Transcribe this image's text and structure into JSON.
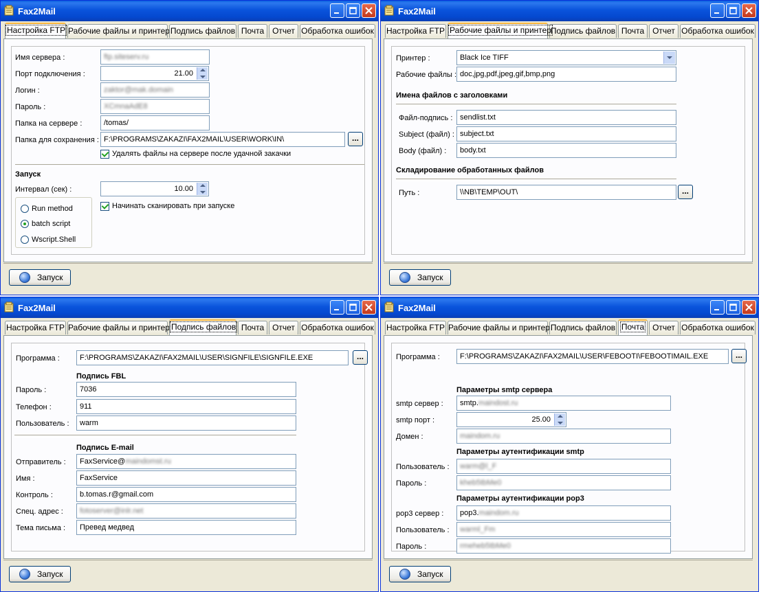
{
  "app_title": "Fax2Mail",
  "tabs": [
    "Настройка FTP",
    "Рабочие файлы и принтер",
    "Подпись файлов",
    "Почта",
    "Отчет",
    "Обработка ошибок"
  ],
  "run_button": "Запуск",
  "browse_label": "...",
  "ftp": {
    "server_label": "Имя сервера :",
    "server_value": "ftp.siteserv.ru",
    "port_label": "Порт подключения :",
    "port_value": "21.00",
    "login_label": "Логин :",
    "login_value": "zaktor@mak.domain",
    "password_label": "Пароль :",
    "password_value": "XCmnaAdE8",
    "folder_label": "Папка на сервере :",
    "folder_value": "/tomas/",
    "save_label": "Папка для сохранения :",
    "save_value": "F:\\PROGRAMS\\ZAKAZI\\FAX2MAIL\\USER\\WORK\\IN\\",
    "delete_label": "Удалять файлы на сервере после удачной закачки",
    "launch_header": "Запуск",
    "interval_label": "Интервал (сек) :",
    "interval_value": "10.00",
    "scan_label": "Начинать сканировать при запуске",
    "radios": [
      "Run method",
      "batch script",
      "Wscript.Shell"
    ]
  },
  "work": {
    "printer_label": "Принтер :",
    "printer_value": "Black Ice TIFF",
    "files_label": "Рабочие файлы :",
    "files_value": "doc,jpg,pdf,jpeg,gif,bmp,png",
    "header_names": "Имена файлов с заголовками",
    "sig_label": "Файл-подпись :",
    "sig_value": "sendlist.txt",
    "subject_label": "Subject (файл) :",
    "subject_value": "subject.txt",
    "body_label": "Body (файл) :",
    "body_value": "body.txt",
    "header_store": "Складирование обработанных файлов",
    "path_label": "Путь :",
    "path_value": "\\\\NB\\TEMP\\OUT\\"
  },
  "sign": {
    "prog_label": "Программа :",
    "prog_value": "F:\\PROGRAMS\\ZAKAZI\\FAX2MAIL\\USER\\SIGNFILE\\SIGNFILE.EXE",
    "fbl_header": "Подпись FBL",
    "pass_label": "Пароль :",
    "pass_value": "7036",
    "phone_label": "Телефон :",
    "phone_value": "911",
    "user_label": "Пользователь :",
    "user_value": "warm",
    "email_header": "Подпись E-mail",
    "sender_label": "Отправитель :",
    "sender_value": "FaxService@",
    "sender_blur": "maindomst.ru",
    "name_label": "Имя :",
    "name_value": "FaxService",
    "control_label": "Контроль :",
    "control_value": "b.tomas.r@gmail.com",
    "special_label": "Спец. адрес :",
    "special_value": "fotoserver@inlr.net",
    "subject_label": "Тема письма :",
    "subject_value": "Превед медвед"
  },
  "mail": {
    "prog_label": "Программа :",
    "prog_value": "F:\\PROGRAMS\\ZAKAZI\\FAX2MAIL\\USER\\FEBOOTI\\FEBOOTIMAIL.EXE",
    "smtp_header": "Параметры smtp сервера",
    "smtp_server_label": "smtp сервер :",
    "smtp_server_value": "smtp.",
    "smtp_server_blur": "maindost.ru",
    "smtp_port_label": "smtp порт :",
    "smtp_port_value": "25.00",
    "domain_label": "Домен :",
    "domain_value": "maindom.ru",
    "auth_smtp_header": "Параметры аутентификации smtp",
    "user_label": "Пользователь :",
    "user_value": "warm@l_F",
    "pass_label": "Пароль :",
    "pass_value": "kheb5tbMe0",
    "auth_pop3_header": "Параметры аутентификации pop3",
    "pop3_label": "pop3 сервер :",
    "pop3_value": "pop3.",
    "pop3_blur": "maindom.ru",
    "user2_label": "Пользователь :",
    "user2_value": "warml_Fm",
    "pass2_label": "Пароль :",
    "pass2_value": "rmeheb5tbMe0"
  }
}
